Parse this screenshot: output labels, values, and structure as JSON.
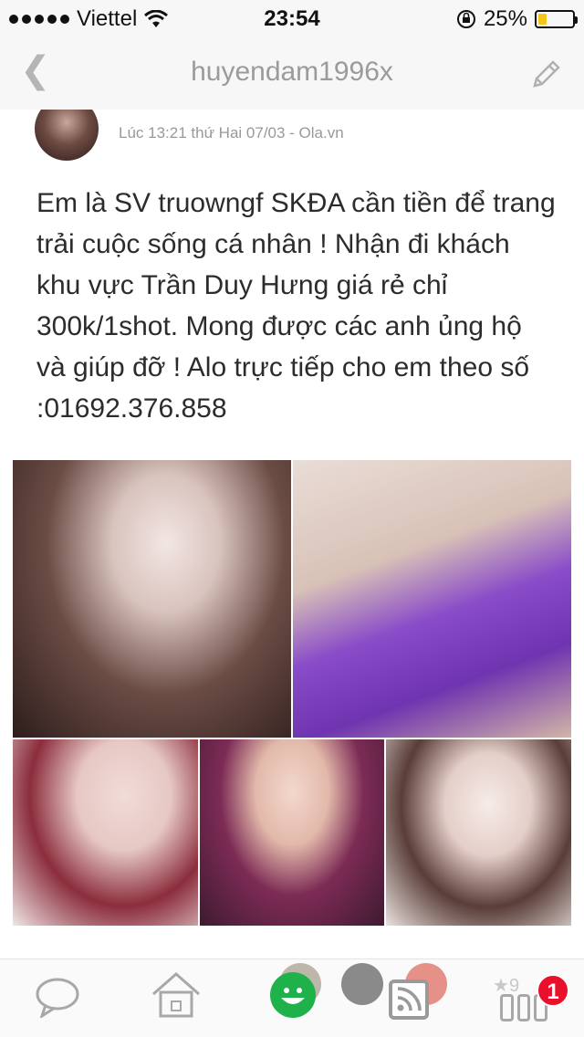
{
  "status_bar": {
    "carrier": "Viettel",
    "time": "23:54",
    "battery_percent": "25%",
    "battery_level": 0.25,
    "battery_color": "#f5c518"
  },
  "nav": {
    "back_icon": "chevron-left-icon",
    "title": "huyendam1996x",
    "edit_icon": "pencil-icon"
  },
  "post": {
    "meta": "Lúc 13:21 thứ Hai 07/03 - Ola.vn",
    "body": "Em là SV truowngf SKĐA cần tiền để trang trải cuộc sống cá nhân ! Nhận đi khách khu vực Trần Duy Hưng giá rẻ chỉ 300k/1shot. Mong được các anh ủng hộ và giúp đỡ ! Alo trực tiếp cho em theo số :01692.376.858",
    "photos": [
      "photo-1",
      "photo-2",
      "photo-3",
      "photo-4",
      "photo-5"
    ]
  },
  "tabbar": {
    "items": [
      "chat-icon",
      "home-icon",
      "smiley-icon",
      "rss-icon",
      "apps-icon"
    ],
    "star_count": "9",
    "badge": "1",
    "accent": "#1fb24a",
    "badge_color": "#e8102a"
  }
}
